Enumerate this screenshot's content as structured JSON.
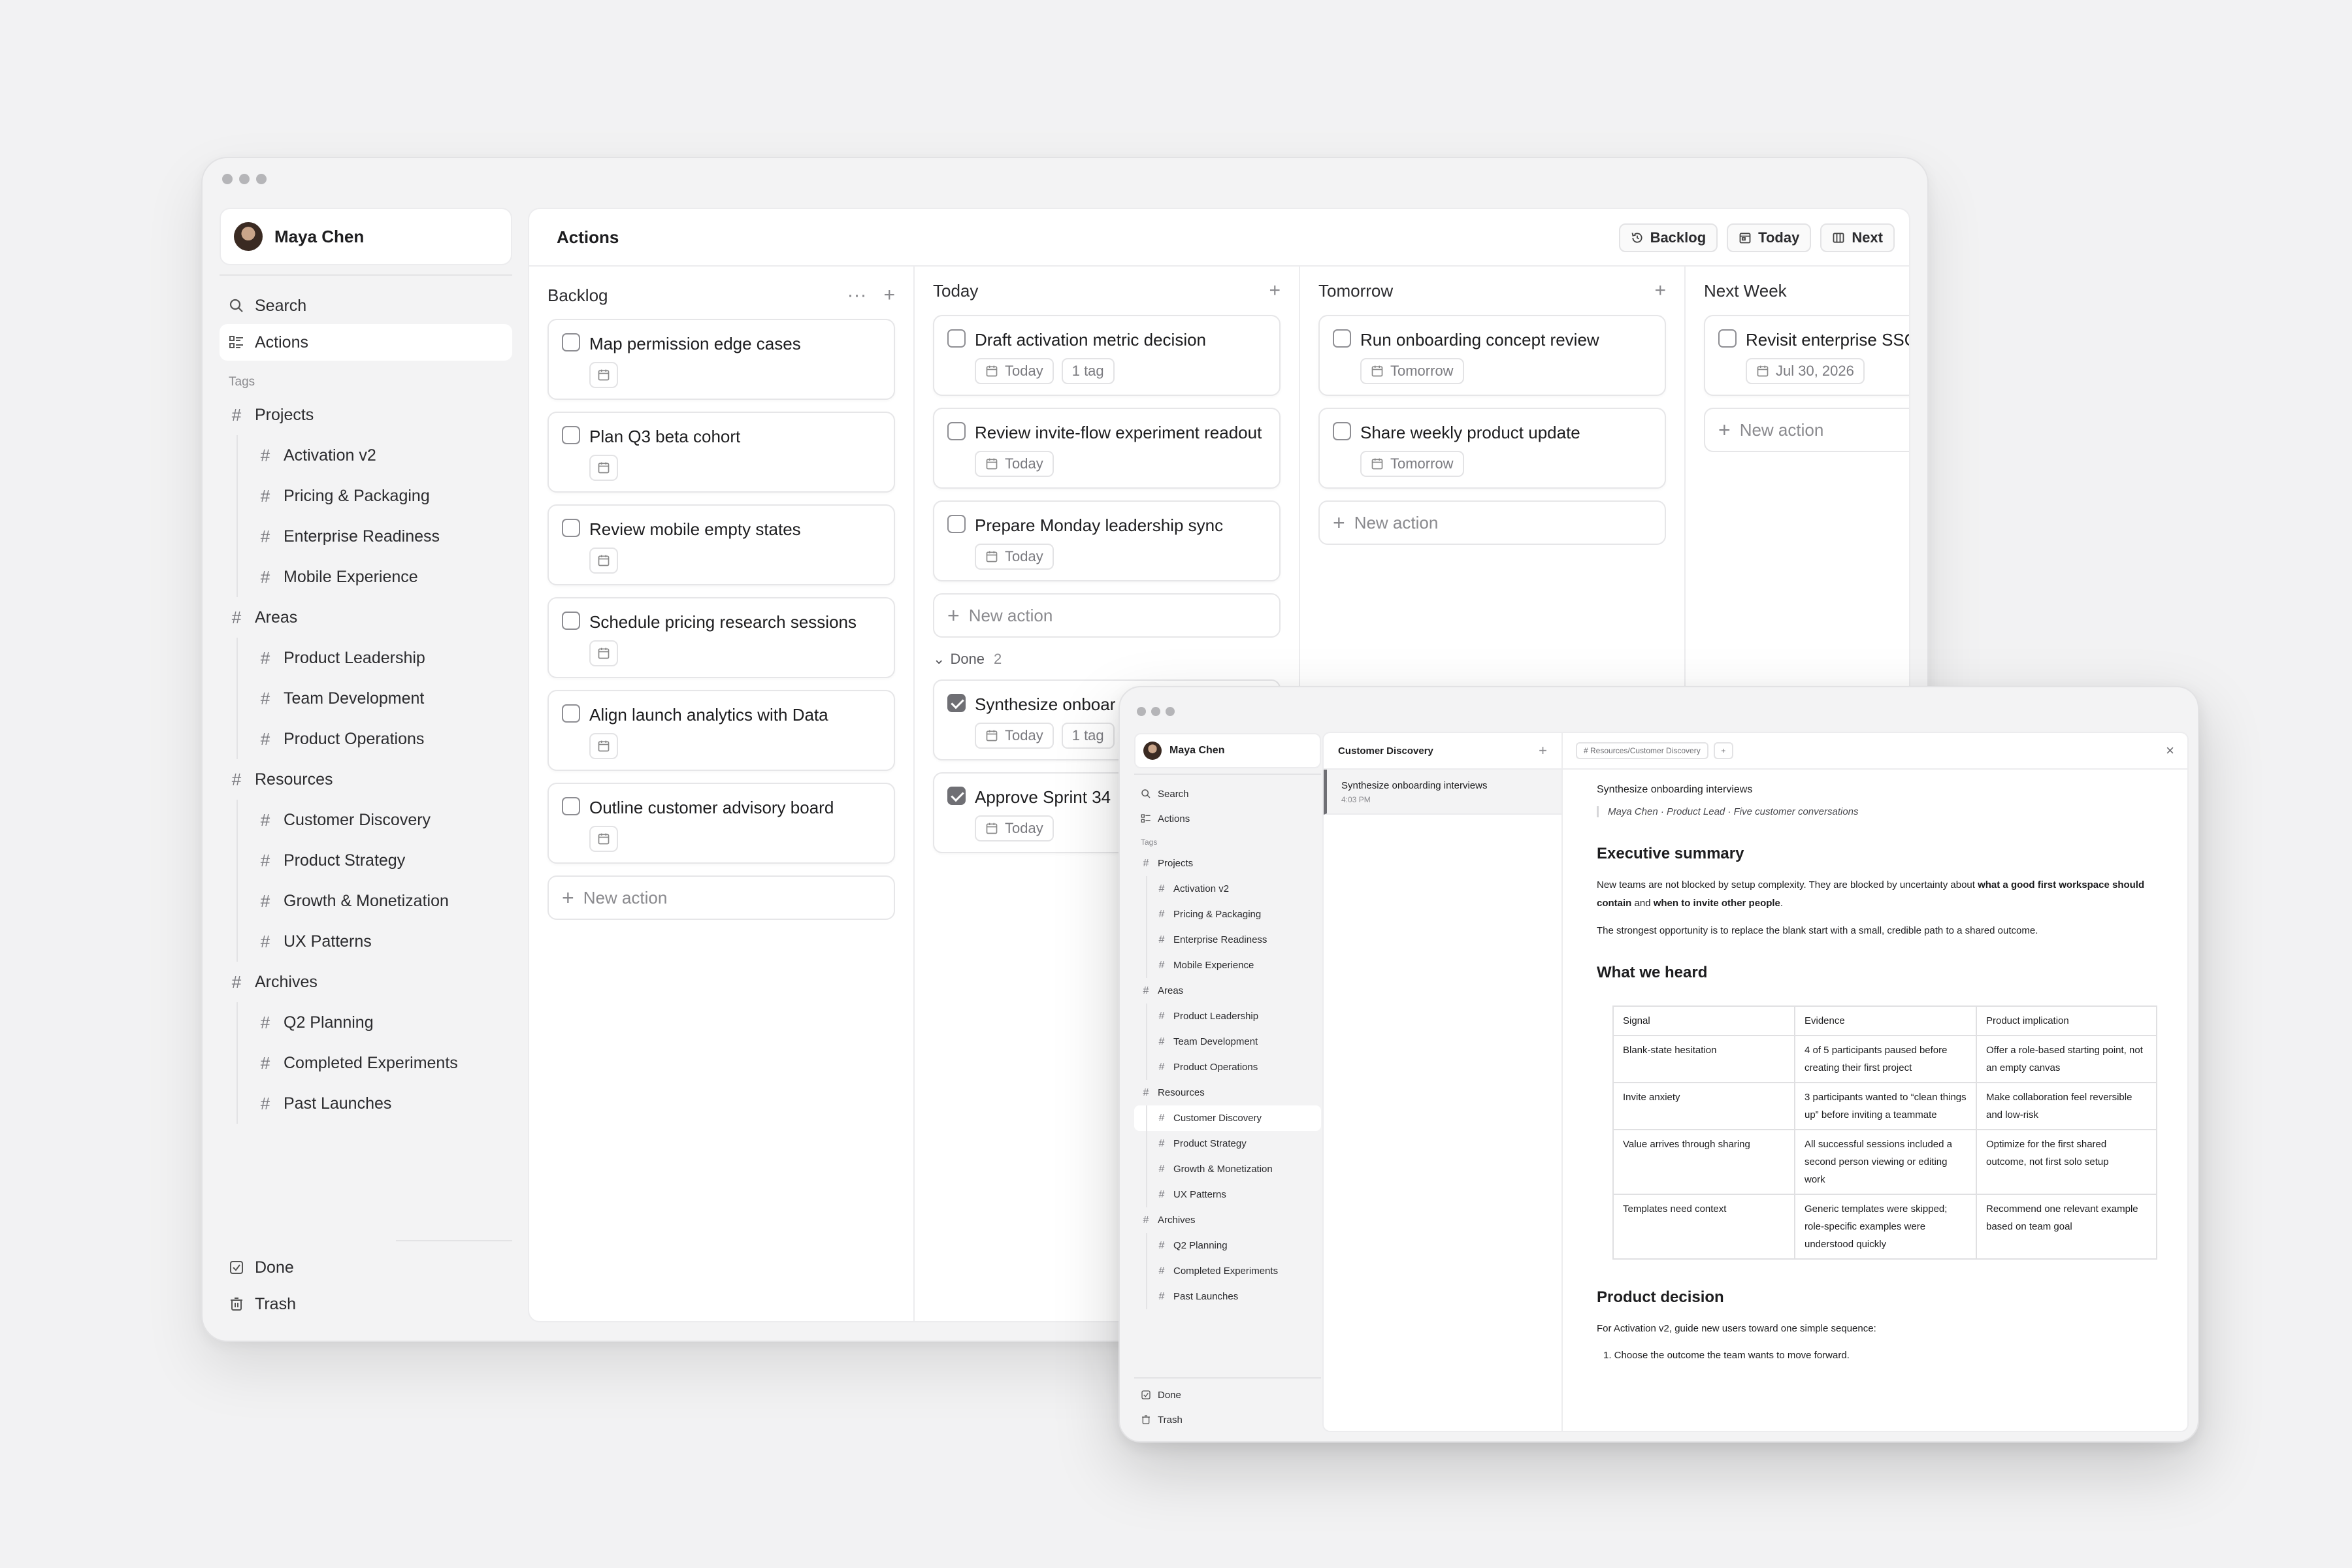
{
  "main_window": {
    "user_name": "Maya Chen",
    "nav": {
      "search": "Search",
      "actions": "Actions"
    },
    "tags_label": "Tags",
    "tags": [
      {
        "label": "Projects",
        "children": [
          "Activation v2",
          "Pricing & Packaging",
          "Enterprise Readiness",
          "Mobile Experience"
        ]
      },
      {
        "label": "Areas",
        "children": [
          "Product Leadership",
          "Team Development",
          "Product Operations"
        ]
      },
      {
        "label": "Resources",
        "children": [
          "Customer Discovery",
          "Product Strategy",
          "Growth & Monetization",
          "UX Patterns"
        ]
      },
      {
        "label": "Archives",
        "children": [
          "Q2 Planning",
          "Completed Experiments",
          "Past Launches"
        ]
      }
    ],
    "bottom": {
      "done": "Done",
      "trash": "Trash"
    },
    "header": {
      "title": "Actions",
      "buttons": {
        "backlog": "Backlog",
        "today": "Today",
        "next": "Next"
      }
    },
    "new_action": "New action",
    "columns": {
      "backlog": {
        "title": "Backlog",
        "cards": [
          "Map permission edge cases",
          "Plan Q3 beta cohort",
          "Review mobile empty states",
          "Schedule pricing research sessions",
          "Align launch analytics with Data",
          "Outline customer advisory board"
        ]
      },
      "today": {
        "title": "Today",
        "cards": [
          {
            "title": "Draft activation metric decision",
            "date": "Today",
            "tags": "1 tag"
          },
          {
            "title": "Review invite-flow experiment readout",
            "date": "Today"
          },
          {
            "title": "Prepare Monday leadership sync",
            "date": "Today"
          }
        ],
        "done_label": "Done",
        "done_count": "2",
        "done_cards": [
          {
            "title": "Synthesize onboar",
            "date": "Today",
            "tags": "1 tag"
          },
          {
            "title": "Approve Sprint 34",
            "date": "Today"
          }
        ]
      },
      "tomorrow": {
        "title": "Tomorrow",
        "cards": [
          {
            "title": "Run onboarding concept review",
            "date": "Tomorrow"
          },
          {
            "title": "Share weekly product update",
            "date": "Tomorrow"
          }
        ]
      },
      "next_week": {
        "title": "Next Week",
        "cards": [
          {
            "title": "Revisit enterprise SSO",
            "date": "Jul 30, 2026"
          }
        ]
      }
    }
  },
  "secondary_window": {
    "user_name": "Maya Chen",
    "nav": {
      "search": "Search",
      "actions": "Actions"
    },
    "tags_label": "Tags",
    "list": {
      "title": "Customer Discovery",
      "note_title": "Synthesize onboarding interviews",
      "note_time": "4:03 PM"
    },
    "doc": {
      "breadcrumb": "# Resources/Customer Discovery",
      "add": "+",
      "close": "×",
      "title": "Synthesize onboarding interviews",
      "quote": "Maya Chen · Product Lead · Five customer conversations",
      "h_summary": "Executive summary",
      "p1_a": "New teams are not blocked by setup complexity. They are blocked by uncertainty about ",
      "p1_b": "what a good first workspace should contain",
      "p1_c": " and ",
      "p1_d": "when to invite other people",
      "p1_e": ".",
      "p2": "The strongest opportunity is to replace the blank start with a small, credible path to a shared outcome.",
      "h_heard": "What we heard",
      "table": {
        "headers": [
          "Signal",
          "Evidence",
          "Product implication"
        ],
        "rows": [
          [
            "Blank-state hesitation",
            "4 of 5 participants paused before creating their first project",
            "Offer a role-based starting point, not an empty canvas"
          ],
          [
            "Invite anxiety",
            "3 participants wanted to “clean things up” before inviting a teammate",
            "Make collaboration feel reversible and low-risk"
          ],
          [
            "Value arrives through sharing",
            "All successful sessions included a second person viewing or editing work",
            "Optimize for the first shared outcome, not first solo setup"
          ],
          [
            "Templates need context",
            "Generic templates were skipped; role-specific examples were understood quickly",
            "Recommend one relevant example based on team goal"
          ]
        ]
      },
      "h_decision": "Product decision",
      "p3": "For Activation v2, guide new users toward one simple sequence:",
      "li1": "1.  Choose the outcome the team wants to move forward."
    }
  }
}
